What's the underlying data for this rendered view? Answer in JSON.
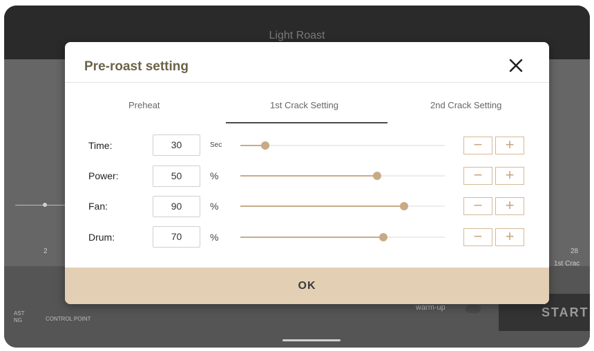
{
  "app": {
    "title": "Light Roast",
    "chart_ticks": {
      "left": "2",
      "right": "28",
      "right_sub": "1st Crac"
    },
    "bottom": {
      "left_labels": [
        "AST",
        "NG"
      ],
      "control_point": "CONTROL POINT",
      "warmup_label": "warm-up",
      "start_label": "START"
    }
  },
  "dialog": {
    "title": "Pre-roast setting",
    "tabs": [
      {
        "label": "Preheat",
        "active": false
      },
      {
        "label": "1st Crack Setting",
        "active": true
      },
      {
        "label": "2nd Crack Setting",
        "active": false
      }
    ],
    "rows": [
      {
        "label": "Time:",
        "value": "30",
        "unit": "Sec",
        "slider_fraction": 0.12
      },
      {
        "label": "Power:",
        "value": "50",
        "unit": "%",
        "slider_fraction": 0.67
      },
      {
        "label": "Fan:",
        "value": "90",
        "unit": "%",
        "slider_fraction": 0.8
      },
      {
        "label": "Drum:",
        "value": "70",
        "unit": "%",
        "slider_fraction": 0.7
      }
    ],
    "stepper": {
      "minus": "−",
      "plus": "+"
    },
    "ok_label": "OK"
  },
  "colors": {
    "accent": "#c9aa86",
    "ok_background": "#e3cfb4",
    "title_text": "#6b6348"
  },
  "icons": {
    "close": "close-icon"
  }
}
